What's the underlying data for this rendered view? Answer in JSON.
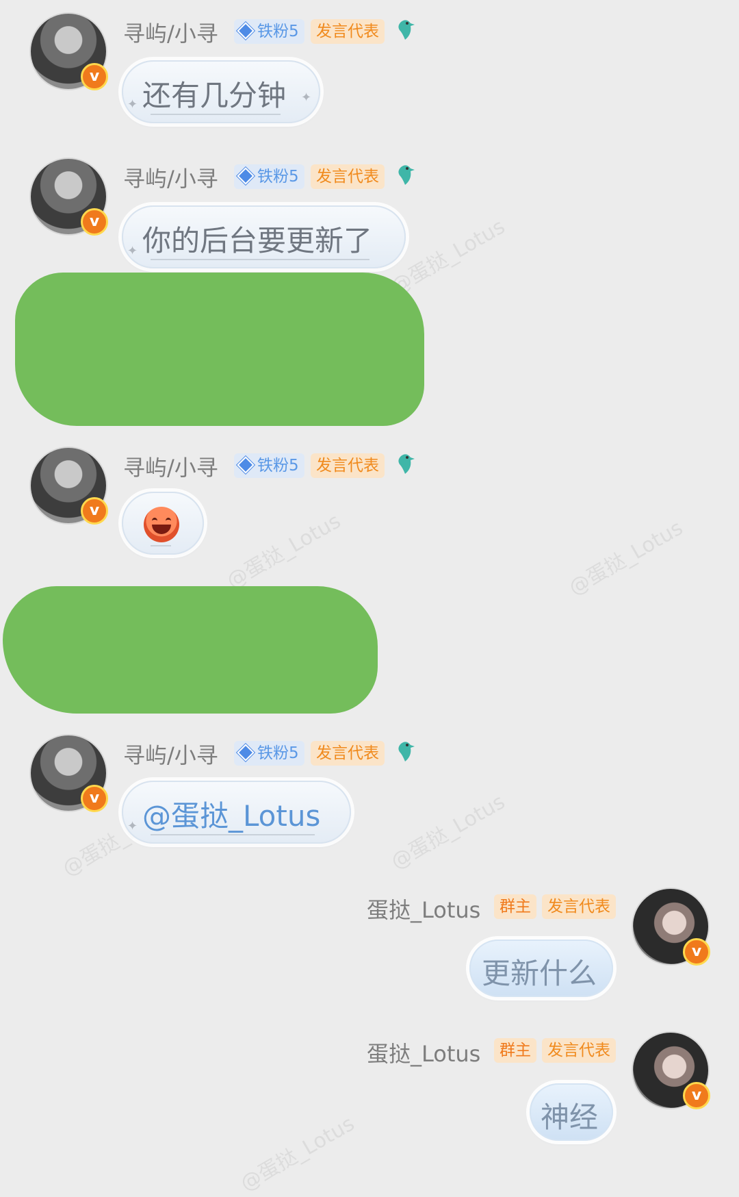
{
  "watermark": "@蛋挞_Lotus",
  "messages": [
    {
      "sender": "寻屿/小寻",
      "fan_badge": "铁粉5",
      "role_badge": "发言代表",
      "text": "还有几分钟"
    },
    {
      "sender": "寻屿/小寻",
      "fan_badge": "铁粉5",
      "role_badge": "发言代表",
      "text": "你的后台要更新了"
    },
    {
      "sender": "寻屿/小寻",
      "fan_badge": "铁粉5",
      "role_badge": "发言代表",
      "text": ""
    },
    {
      "sender": "寻屿/小寻",
      "fan_badge": "铁粉5",
      "role_badge": "发言代表",
      "text": "@蛋挞_Lotus"
    },
    {
      "sender": "蛋挞_Lotus",
      "owner_badge": "群主",
      "role_badge": "发言代表",
      "text": "更新什么"
    },
    {
      "sender": "蛋挞_Lotus",
      "owner_badge": "群主",
      "role_badge": "发言代表",
      "text": "神经"
    }
  ],
  "icons": {
    "verified": "v-badge-icon",
    "fan_level": "diamond-icon",
    "bird": "bird-icon",
    "emoji": "laughing-emoji-icon"
  },
  "colors": {
    "background": "#ececec",
    "redaction": "#74bd5b",
    "verified_badge": "#f07a1c",
    "fan_badge_text": "#5a98e6",
    "speaker_badge_text": "#f08a1d"
  }
}
